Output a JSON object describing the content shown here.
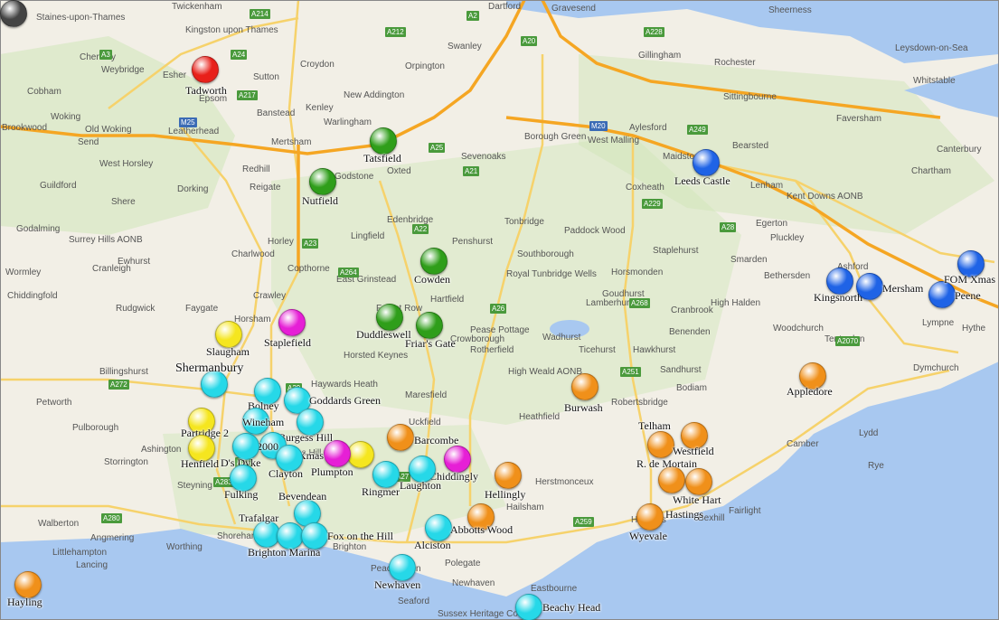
{
  "colors": {
    "land": "#f2efe6",
    "sea": "#a8c8f0",
    "motorway": "#f5a623",
    "a_road": "#f6d26b",
    "park": "#c9e3b0",
    "red": "#e8201a",
    "green": "#2f9e1a",
    "blue": "#1f63e6",
    "yellow": "#f5e61f",
    "magenta": "#e61fd6",
    "cyan": "#26d8e8",
    "orange": "#f0901a",
    "grey": "#444444"
  },
  "places": [
    "Staines-upon-Thames",
    "Twickenham",
    "Kingston upon Thames",
    "Dartford",
    "Gravesend",
    "Sheerness",
    "Chertsey",
    "Weybridge",
    "Esher",
    "Sutton",
    "Croydon",
    "Orpington",
    "Swanley",
    "Gillingham",
    "Rochester",
    "Leysdown-on-Sea",
    "Cobham",
    "Epsom",
    "Banstead",
    "New Addington",
    "Sittingbourne",
    "Whitstable",
    "Woking",
    "Leatherhead",
    "Kenley",
    "Warlingham",
    "West Malling",
    "Aylesford",
    "Faversham",
    "Brookwood",
    "Send",
    "Old Woking",
    "Sevenoaks",
    "Oxted",
    "Borough Green",
    "Maidstone",
    "Canterbury",
    "West Horsley",
    "Mertsham",
    "Redhill",
    "Bearsted",
    "Chartham",
    "Guildford",
    "Dorking",
    "Reigate",
    "Coxheath",
    "Lenham",
    "Kent Downs AONB",
    "Shere",
    "Godstone",
    "Edenbridge",
    "Tonbridge",
    "Paddock Wood",
    "Egerton",
    "Godalming",
    "Horley",
    "Lingfield",
    "Penshurst",
    "Staplehurst",
    "Pluckley",
    "Surrey Hills AONB",
    "Charlwood",
    "Southborough",
    "Ashford",
    "Cranleigh",
    "Ewhurst",
    "Copthorne",
    "East Grinstead",
    "Royal Tunbridge Wells",
    "Horsmonden",
    "Smarden",
    "Bethersden",
    "Wormley",
    "Crawley",
    "Goudhurst",
    "High Halden",
    "Chiddingfold",
    "Rudgwick",
    "Faygate",
    "Hartfield",
    "Lamberhurst",
    "Cranbrook",
    "Hythe",
    "Forest Row",
    "Horsham",
    "Pease Pottage",
    "Wadhurst",
    "Benenden",
    "Woodchurch",
    "Lympne",
    "Horsted Keynes",
    "Crowborough",
    "Rotherfield",
    "Ticehurst",
    "Hawkhurst",
    "Tenterden",
    "Billingshurst",
    "Haywards Heath",
    "High Weald AONB",
    "Sandhurst",
    "Dymchurch",
    "Maresfield",
    "Bodiam",
    "Petworth",
    "Uckfield",
    "Heathfield",
    "Robertsbridge",
    "Pulborough",
    "Burgess Hill",
    "Lydd",
    "Ashington",
    "Storrington",
    "Herstmonceux",
    "Camber",
    "Steyning",
    "Hailsham",
    "Bexhill",
    "Fairlight",
    "Walberton",
    "Worthing",
    "Littlehampton",
    "Shoreham-by-Sea",
    "Brighton",
    "Polegate",
    "Angmering",
    "Eastbourne",
    "Seaford",
    "Lancing",
    "Peacehaven",
    "Sussex Heritage Coast",
    "Newhaven",
    "Rye",
    "Hastings"
  ],
  "roads": [
    "A214",
    "A3",
    "A24",
    "A217",
    "A212",
    "A20",
    "A2",
    "A228",
    "A249",
    "M25",
    "M20",
    "A21",
    "A25",
    "A22",
    "A26",
    "A264",
    "A272",
    "A23",
    "A29",
    "A27",
    "A259",
    "A24",
    "A283",
    "A280",
    "A2070",
    "A28",
    "A268",
    "A229",
    "A251"
  ],
  "markers": [
    {
      "label": "Tadworth",
      "color": "red"
    },
    {
      "label": "Tatsfield",
      "color": "green"
    },
    {
      "label": "Nutfield",
      "color": "green"
    },
    {
      "label": "Cowden",
      "color": "green"
    },
    {
      "label": "Duddleswell",
      "color": "green"
    },
    {
      "label": "Friar's Gate",
      "color": "green"
    },
    {
      "label": "Leeds Castle",
      "color": "blue"
    },
    {
      "label": "Kingsnorth",
      "color": "blue"
    },
    {
      "label": "Mersham",
      "color": "blue"
    },
    {
      "label": "Peene",
      "color": "blue"
    },
    {
      "label": "FOM Xmas",
      "color": "blue"
    },
    {
      "label": "Slaugham",
      "color": "yellow"
    },
    {
      "label": "Partridge 2",
      "color": "yellow"
    },
    {
      "label": "Henfield",
      "color": "yellow"
    },
    {
      "label": "Plumpton",
      "color": "yellow"
    },
    {
      "label": "Staplefield",
      "color": "magenta"
    },
    {
      "label": "Xmas",
      "color": "magenta"
    },
    {
      "label": "Chiddingly",
      "color": "magenta"
    },
    {
      "label": "Shermanbury",
      "color": "cyan"
    },
    {
      "label": "Bolney",
      "color": "cyan"
    },
    {
      "label": "Goddards Green",
      "color": "cyan"
    },
    {
      "label": "Wineham",
      "color": "cyan"
    },
    {
      "label": "Burgess Hill",
      "color": "cyan"
    },
    {
      "label": "2000",
      "color": "cyan"
    },
    {
      "label": "D's Dyke",
      "color": "cyan"
    },
    {
      "label": "Clayton",
      "color": "cyan"
    },
    {
      "label": "Fulking",
      "color": "cyan"
    },
    {
      "label": "Ringmer",
      "color": "cyan"
    },
    {
      "label": "Laughton",
      "color": "cyan"
    },
    {
      "label": "Bevendean",
      "color": "cyan"
    },
    {
      "label": "Trafalgar",
      "color": "cyan"
    },
    {
      "label": "Brighton Marina",
      "color": "cyan"
    },
    {
      "label": "Fox on the Hill",
      "color": "cyan"
    },
    {
      "label": "Alciston",
      "color": "cyan"
    },
    {
      "label": "Newhaven",
      "color": "cyan"
    },
    {
      "label": "Beachy Head",
      "color": "cyan"
    },
    {
      "label": "Barcombe",
      "color": "orange"
    },
    {
      "label": "Hellingly",
      "color": "orange"
    },
    {
      "label": "Abbotts Wood",
      "color": "orange"
    },
    {
      "label": "Burwash",
      "color": "orange"
    },
    {
      "label": "Telham",
      "color": "orange"
    },
    {
      "label": "Westfield",
      "color": "orange"
    },
    {
      "label": "R. de Mortain",
      "color": "orange"
    },
    {
      "label": "White Hart",
      "color": "orange"
    },
    {
      "label": "Hastings",
      "color": "orange"
    },
    {
      "label": "Wyevale",
      "color": "orange"
    },
    {
      "label": "Appledore",
      "color": "orange"
    },
    {
      "label": "Hayling",
      "color": "grey"
    }
  ]
}
